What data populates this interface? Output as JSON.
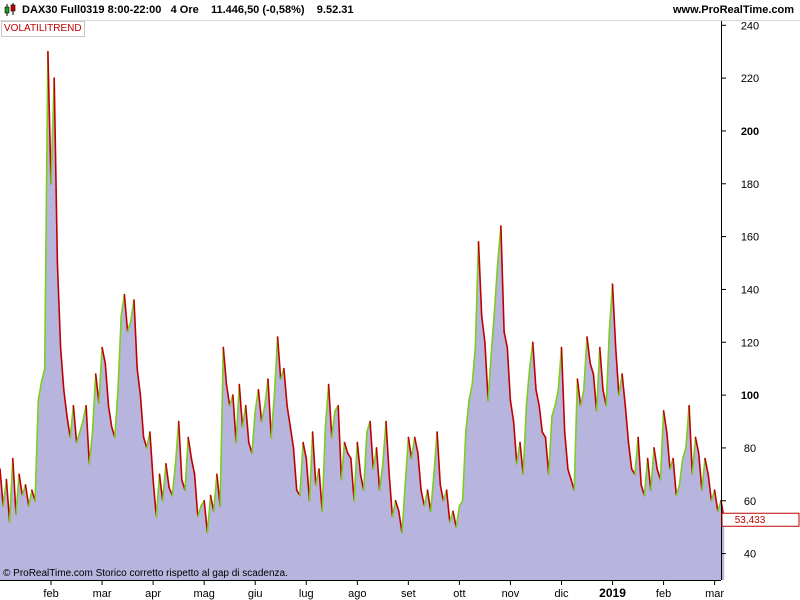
{
  "header": {
    "instrument": "DAX30 Full0319 8:00-22:00",
    "timeframe": "4 Ore",
    "price_change": "11.446,50 (-0,58%)",
    "time": "9.52.31",
    "brand": "www.ProRealTime.com"
  },
  "indicator": {
    "name": "VOLATILITREND"
  },
  "footer": {
    "note": "© ProRealTime.com  Storico corretto rispetto al gap di scadenza."
  },
  "colors": {
    "area": "#b7b5dd",
    "rising": "#7ccd1e",
    "falling": "#c00000",
    "background": "#ffffff"
  },
  "chart_data": {
    "type": "area",
    "title": "",
    "ylim": [
      30,
      242
    ],
    "y_ticks": [
      40,
      60,
      80,
      100,
      120,
      140,
      160,
      180,
      200,
      220,
      240
    ],
    "y_ticks_bold": [
      100,
      200
    ],
    "last_value": "53,433",
    "x_labels": [
      {
        "label": "feb",
        "at": 16
      },
      {
        "label": "mar",
        "at": 32
      },
      {
        "label": "apr",
        "at": 48
      },
      {
        "label": "mag",
        "at": 64
      },
      {
        "label": "giu",
        "at": 80
      },
      {
        "label": "lug",
        "at": 96
      },
      {
        "label": "ago",
        "at": 112
      },
      {
        "label": "set",
        "at": 128
      },
      {
        "label": "ott",
        "at": 144
      },
      {
        "label": "nov",
        "at": 160
      },
      {
        "label": "dic",
        "at": 176
      },
      {
        "label": "2019",
        "at": 192,
        "bold": true
      },
      {
        "label": "feb",
        "at": 208
      },
      {
        "label": "mar",
        "at": 224
      }
    ],
    "series": [
      {
        "values": [
          72,
          58,
          68,
          52,
          76,
          55,
          70,
          62,
          66,
          58,
          64,
          60,
          98,
          105,
          110,
          230,
          180,
          220,
          150,
          118,
          102,
          92,
          84,
          96,
          82,
          86,
          90,
          96,
          74,
          86,
          108,
          97,
          118,
          112,
          96,
          88,
          84,
          102,
          130,
          138,
          124,
          128,
          136,
          110,
          100,
          84,
          80,
          86,
          68,
          54,
          70,
          60,
          74,
          65,
          62,
          74,
          90,
          68,
          64,
          84,
          76,
          70,
          54,
          58,
          60,
          48,
          62,
          56,
          70,
          58,
          118,
          104,
          96,
          100,
          82,
          104,
          88,
          96,
          82,
          78,
          94,
          102,
          90,
          96,
          106,
          84,
          100,
          122,
          106,
          110,
          96,
          88,
          80,
          64,
          62,
          82,
          76,
          60,
          86,
          66,
          72,
          56,
          88,
          104,
          84,
          94,
          96,
          68,
          82,
          78,
          76,
          60,
          82,
          70,
          64,
          86,
          90,
          72,
          80,
          64,
          74,
          90,
          70,
          54,
          60,
          56,
          48,
          66,
          84,
          76,
          84,
          78,
          64,
          58,
          64,
          56,
          70,
          86,
          66,
          60,
          64,
          52,
          56,
          50,
          58,
          60,
          86,
          98,
          104,
          118,
          158,
          130,
          120,
          98,
          116,
          132,
          150,
          164,
          124,
          118,
          98,
          90,
          74,
          82,
          70,
          96,
          110,
          120,
          102,
          96,
          86,
          84,
          70,
          92,
          96,
          102,
          118,
          86,
          72,
          68,
          64,
          106,
          96,
          102,
          122,
          112,
          108,
          94,
          118,
          102,
          96,
          124,
          142,
          118,
          100,
          108,
          96,
          82,
          72,
          70,
          84,
          66,
          62,
          76,
          64,
          80,
          72,
          68,
          94,
          86,
          72,
          76,
          62,
          66,
          76,
          80,
          96,
          70,
          84,
          78,
          64,
          76,
          70,
          60,
          64,
          56,
          60,
          53
        ]
      }
    ]
  }
}
